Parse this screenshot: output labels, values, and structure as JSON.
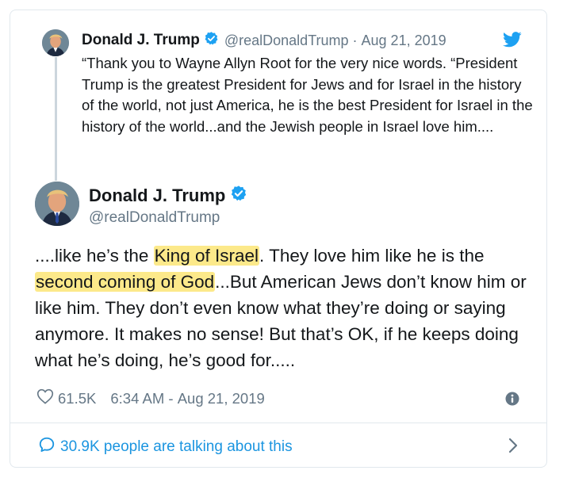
{
  "quoted_tweet": {
    "author_name": "Donald J. Trump",
    "handle": "@realDonaldTrump",
    "separator": "·",
    "date": "Aug 21, 2019",
    "text": "“Thank you to Wayne Allyn Root for the very nice words. “President Trump is the greatest President for Jews and for Israel in the history of the world, not just America, he is the best President for Israel in the history of the world...and the Jewish people in Israel love him...."
  },
  "main_tweet": {
    "author_name": "Donald J. Trump",
    "handle": "@realDonaldTrump",
    "text_parts": {
      "p1": "....like he’s the ",
      "h1": "King of Israel",
      "p2": ". They love him like he is the ",
      "h2": "second coming of God",
      "p3": "...But American Jews don’t know him or like him. They don’t even know what they’re doing or saying anymore. It makes no sense! But that’s OK, if he keeps doing what he’s doing, he’s good for....."
    },
    "likes": "61.5K",
    "time": "6:34 AM",
    "date_separator": " - ",
    "date": "Aug 21, 2019",
    "conversation": "30.9K people are talking about this"
  },
  "colors": {
    "verified_blue": "#1da1f2",
    "link_blue": "#1b95e0",
    "secondary_text": "#657786",
    "highlight": "#fce98a"
  },
  "icons": [
    "verified-badge-icon",
    "twitter-bird-icon",
    "heart-icon",
    "info-icon",
    "speech-bubble-icon",
    "chevron-right-icon"
  ]
}
